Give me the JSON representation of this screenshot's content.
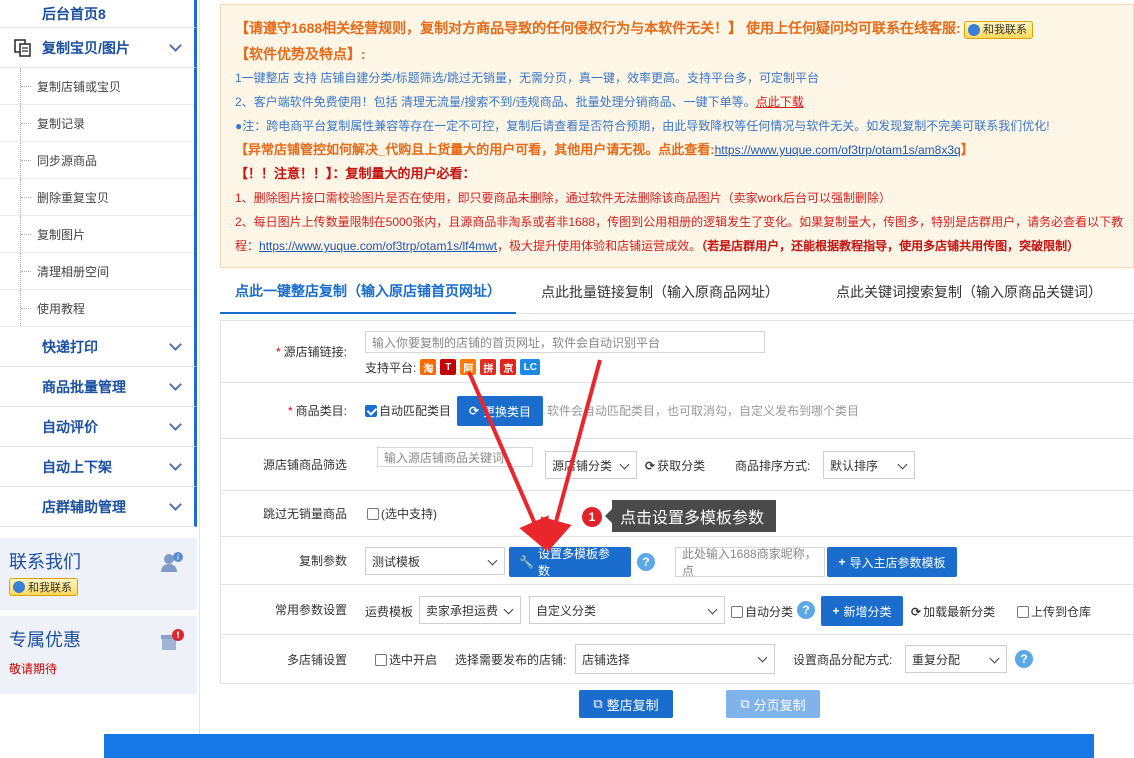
{
  "sidebar": {
    "top_item": "后台首页8",
    "copy_group": "复制宝贝/图片",
    "sub_items": [
      "复制店铺或宝贝",
      "复制记录",
      "同步源商品",
      "删除重复宝贝",
      "复制图片",
      "清理相册空间",
      "使用教程"
    ],
    "groups": [
      "快递打印",
      "商品批量管理",
      "自动评价",
      "自动上下架",
      "店群辅助管理"
    ],
    "contact": {
      "title": "联系我们",
      "qq_label": "和我联系"
    },
    "promo": {
      "title": "专属优惠",
      "sub": "敬请期待"
    }
  },
  "notice": {
    "line1": "【请遵守1688相关经营规则，复制对方商品导致的任何侵权行为与本软件无关！】 使用上任何疑问均可联系在线客服:",
    "qq_label": "和我联系",
    "line2": "【软件优势及特点】:",
    "line3": "1一键整店 支持 店铺自建分类/标题筛选/跳过无销量，无需分页，真一键，效率更高。支持平台多，可定制平台",
    "line4_a": "2、客户端软件免费使用！包括 清理无流量/搜索不到/违规商品、批量处理分销商品、一键下单等。",
    "line4_link": "点此下载",
    "line5": "●注：跨电商平台复制属性兼容等存在一定不可控，复制后请查看是否符合预期，由此导致降权等任何情况与软件无关。如发现复制不完美可联系我们优化!",
    "line6_a": "【异常店铺管控如何解决_代购且上货量大的用户可看，其他用户请无视。点此查看:",
    "line6_link": "https://www.yuque.com/of3trp/otam1s/am8x3q",
    "line6_b": "】",
    "line7": "【！！注意！！】：复制量大的用户必看：",
    "line8": "1、删除图片接口需校验图片是否在使用，即只要商品未删除，通过软件无法删除该商品图片（卖家work后台可以强制删除）",
    "line9": "2、每日图片上传数量限制在5000张内，且源商品非淘系或者非1688，传图到公用相册的逻辑发生了变化。如果复制量大，传图多，特别是店群用户，请务必查看以下教",
    "line10_a": "程：",
    "line10_link": "https://www.yuque.com/of3trp/otam1s/lf4mwt",
    "line10_b": "，极大提升使用体验和店铺运营成效。",
    "line10_c": "（若是店群用户，还能根据教程指导，使用多店铺共用传图，突破限制）"
  },
  "tabs": [
    "点此一键整店复制（输入原店铺首页网址）",
    "点此批量链接复制（输入原商品网址）",
    "点此关键词搜索复制（输入原商品关键词）"
  ],
  "form": {
    "shop_link": {
      "label": "源店铺链接:",
      "placeholder": "输入你要复制的店铺的首页网址，软件会自动识别平台",
      "platforms_label": "支持平台:",
      "platforms": [
        "淘",
        "T",
        "阿",
        "拼",
        "京",
        "LC"
      ]
    },
    "category": {
      "label": "商品类目:",
      "auto_match": "自动匹配类目",
      "change_btn": "更换类目",
      "hint": "软件会自动匹配类目，也可取消勾，自定义发布到哪个类目"
    },
    "filter": {
      "label": "源店铺商品筛选",
      "keyword_placeholder": "输入源店铺商品关键词",
      "shop_category": "源店铺分类",
      "fetch": "获取分类",
      "sort_label": "商品排序方式:",
      "sort_value": "默认排序"
    },
    "skip_no_sales": {
      "label": "跳过无销量商品",
      "option": "(选中支持)"
    },
    "copy_params": {
      "label": "复制参数",
      "template": "测试模板",
      "set_btn": "设置多模板参数",
      "nick_placeholder": "此处输入1688商家昵称，点",
      "import_btn": "导入主店参数模板"
    },
    "common": {
      "label": "常用参数设置",
      "freight_label": "运费模板",
      "freight_value": "卖家承担运费",
      "custom_category": "自定义分类",
      "auto_category": "自动分类",
      "add_category_btn": "新增分类",
      "reload": "加载最新分类",
      "upload_warehouse": "上传到仓库"
    },
    "multi_shop": {
      "label": "多店铺设置",
      "enable": "选中开启",
      "select_label": "选择需要发布的店铺:",
      "select_value": "店铺选择",
      "dist_label": "设置商品分配方式:",
      "dist_value": "重复分配"
    }
  },
  "tooltip": {
    "step": "1",
    "text": "点击设置多模板参数"
  },
  "actions": {
    "shop_copy": "整店复制",
    "page_copy": "分页复制"
  },
  "colors": {
    "primary": "#1a6dcc",
    "notice_bg": "#fdf5e6",
    "orange": "#e56b1a",
    "red": "#d41f1f",
    "arrow_red": "#e8262b"
  }
}
